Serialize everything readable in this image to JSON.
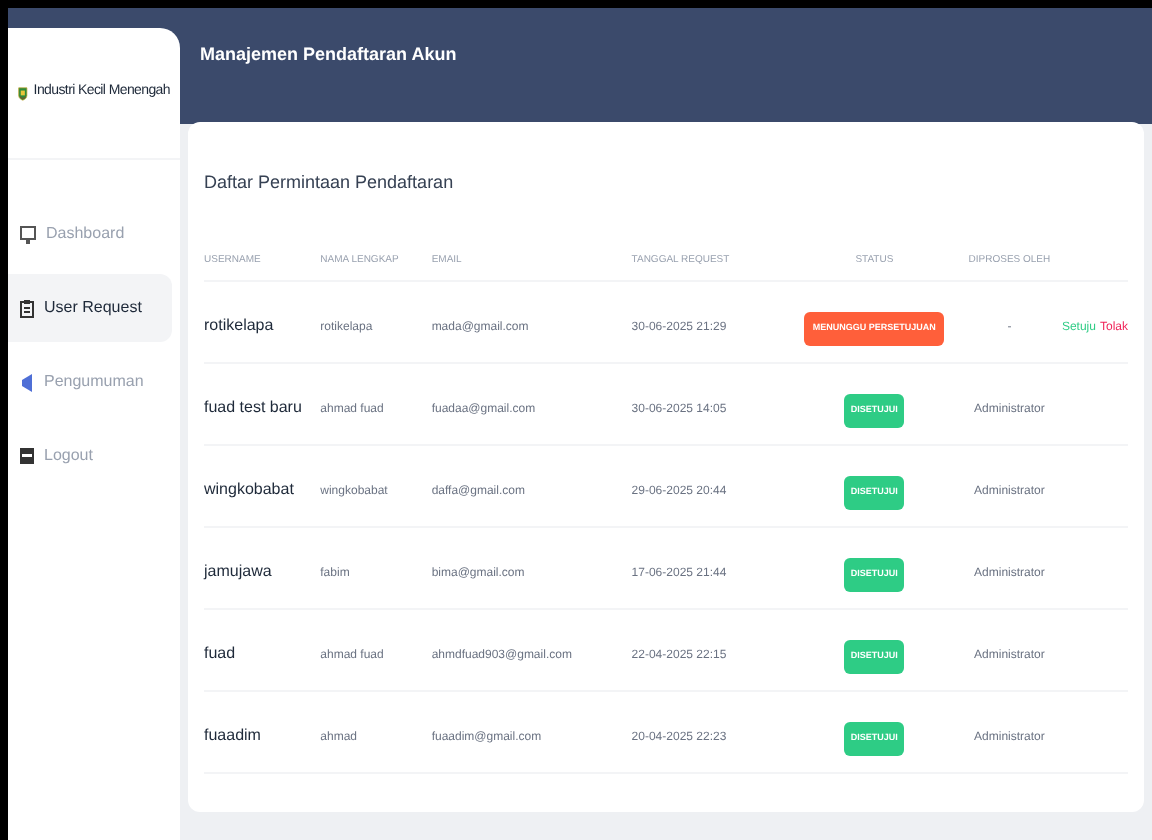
{
  "sidebar": {
    "brand": "Industri Kecil Menengah",
    "items": [
      {
        "label": "Dashboard",
        "kind": "dashboard",
        "selected": false
      },
      {
        "label": "User Request",
        "kind": "requests",
        "selected": true
      },
      {
        "label": "Pengumuman",
        "kind": "announcements",
        "selected": false
      },
      {
        "label": "Logout",
        "kind": "logout",
        "selected": false
      }
    ]
  },
  "header": {
    "title": "Manajemen Pendaftaran Akun"
  },
  "card": {
    "title": "Daftar Permintaan Pendaftaran"
  },
  "table": {
    "columns": [
      "USERNAME",
      "NAMA LENGKAP",
      "EMAIL",
      "TANGGAL REQUEST",
      "STATUS",
      "DIPROSES OLEH"
    ],
    "rows": [
      {
        "username": "rotikelapa",
        "nama": "rotikelapa",
        "email": "mada@gmail.com",
        "tanggal": "30-06-2025 21:29",
        "status": {
          "label": "MENUNGGU PERSETUJUAN",
          "kind": "pending"
        },
        "diproses": "-",
        "actions": [
          {
            "label": "Setuju",
            "kind": "approve"
          },
          {
            "label": "Tolak",
            "kind": "reject"
          }
        ]
      },
      {
        "username": "fuad test baru",
        "nama": "ahmad fuad",
        "email": "fuadaa@gmail.com",
        "tanggal": "30-06-2025 14:05",
        "status": {
          "label": "DISETUJUI",
          "kind": "approved"
        },
        "diproses": "Administrator"
      },
      {
        "username": "wingkobabat",
        "nama": "wingkobabat",
        "email": "daffa@gmail.com",
        "tanggal": "29-06-2025 20:44",
        "status": {
          "label": "DISETUJUI",
          "kind": "approved"
        },
        "diproses": "Administrator"
      },
      {
        "username": "jamujawa",
        "nama": "fabim",
        "email": "bima@gmail.com",
        "tanggal": "17-06-2025 21:44",
        "status": {
          "label": "DISETUJUI",
          "kind": "approved"
        },
        "diproses": "Administrator"
      },
      {
        "username": "fuad",
        "nama": "ahmad fuad",
        "email": "ahmdfuad903@gmail.com",
        "tanggal": "22-04-2025 22:15",
        "status": {
          "label": "DISETUJUI",
          "kind": "approved"
        },
        "diproses": "Administrator"
      },
      {
        "username": "fuaadim",
        "nama": "ahmad",
        "email": "fuaadim@gmail.com",
        "tanggal": "20-04-2025 22:23",
        "status": {
          "label": "DISETUJUI",
          "kind": "approved"
        },
        "diproses": "Administrator"
      }
    ]
  }
}
